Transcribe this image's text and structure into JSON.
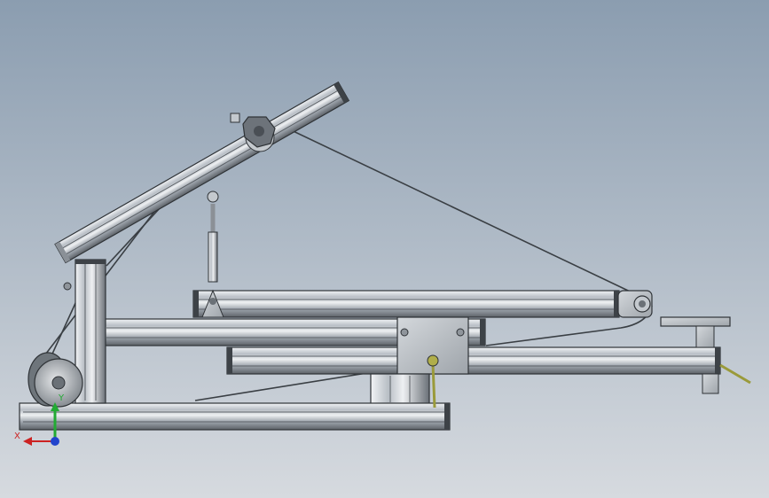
{
  "viewport": {
    "background_top": "#8b9db0",
    "background_bottom": "#d6dadf"
  },
  "colors": {
    "profile_light": "#e3e7ec",
    "profile_mid": "#aeb4bb",
    "profile_dark": "#4a4f55",
    "outline": "#2f3337",
    "cable": "#3a3f44",
    "handle": "#9a9a3a",
    "axis_x": "#cc2222",
    "axis_y": "#22aa33",
    "axis_z": "#2244cc"
  },
  "triad": {
    "x_label": "X",
    "y_label": "Y",
    "x_icon": "x-axis-arrow-icon",
    "y_icon": "y-axis-arrow-icon",
    "z_icon": "z-axis-dot-icon"
  }
}
